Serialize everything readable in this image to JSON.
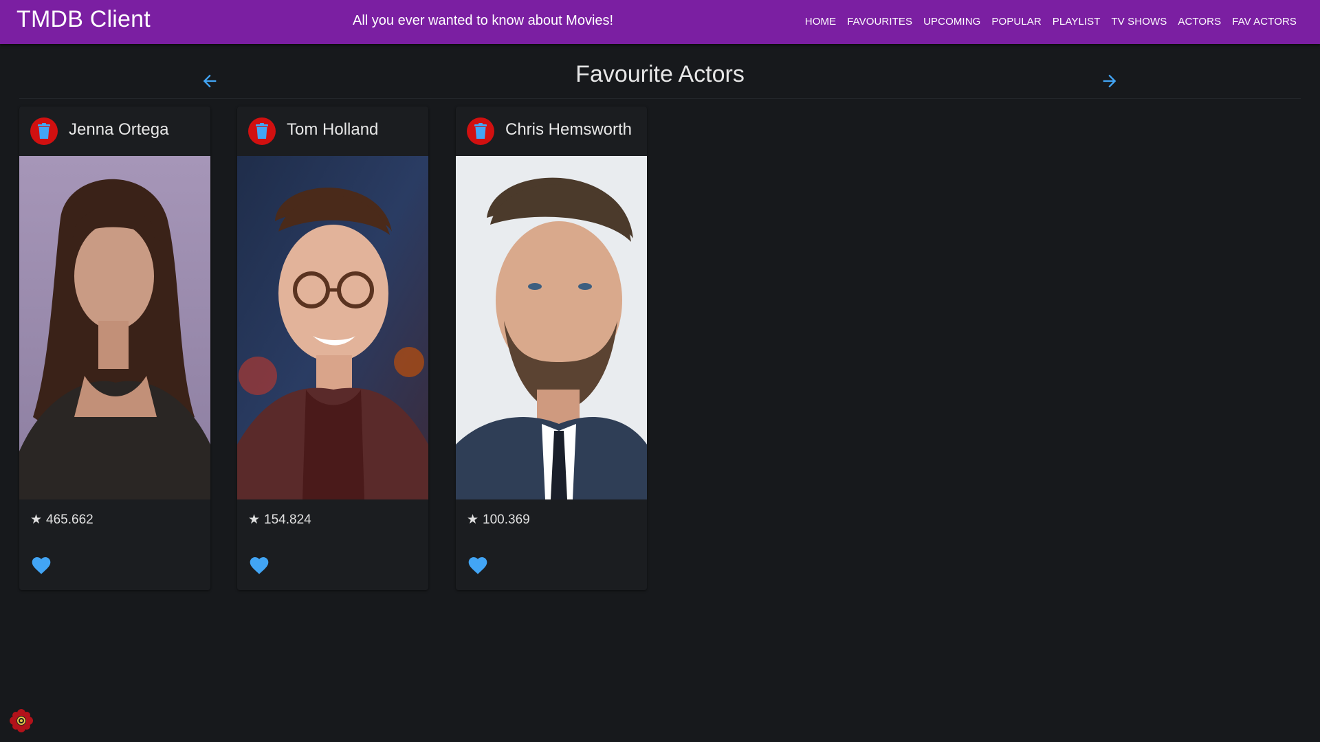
{
  "app": {
    "title": "TMDB Client",
    "tagline": "All you ever wanted to know about Movies!",
    "bar_color": "#7b1fa2"
  },
  "nav": {
    "items": [
      "HOME",
      "FAVOURITES",
      "UPCOMING",
      "POPULAR",
      "PLAYLIST",
      "TV SHOWS",
      "ACTORS",
      "FAV ACTORS"
    ]
  },
  "page": {
    "title": "Favourite Actors",
    "back_icon": "arrow-left-icon",
    "forward_icon": "arrow-right-icon",
    "accent_color": "#42a5f5"
  },
  "actors": [
    {
      "name": "Jenna Ortega",
      "popularity": "465.662"
    },
    {
      "name": "Tom Holland",
      "popularity": "154.824"
    },
    {
      "name": "Chris Hemsworth",
      "popularity": "100.369"
    }
  ],
  "card_icons": {
    "delete": "trash-icon",
    "favourite": "heart-icon",
    "rating": "star-icon",
    "delete_color": "#d11010",
    "heart_color": "#42a5f5"
  }
}
